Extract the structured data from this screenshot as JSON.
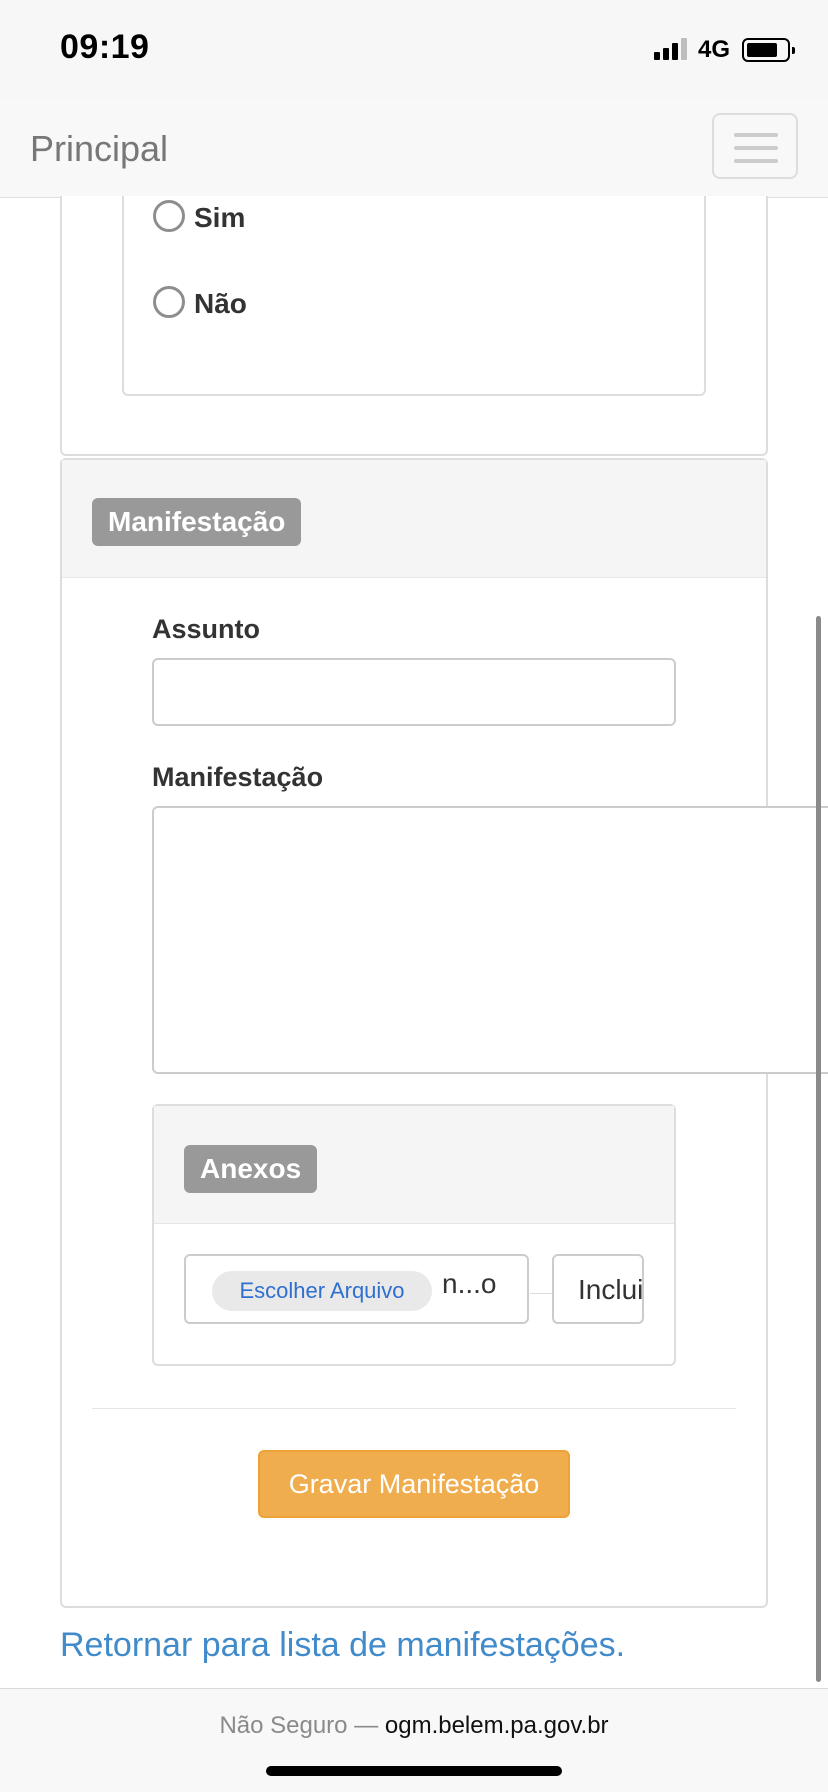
{
  "status_bar": {
    "time": "09:19",
    "network": "4G"
  },
  "navbar": {
    "brand": "Principal",
    "toggle_icon": "hamburger-icon"
  },
  "radio_group": {
    "options": [
      {
        "label": "Sim",
        "checked": false
      },
      {
        "label": "Não",
        "checked": false
      }
    ]
  },
  "manifest_panel": {
    "heading_badge": "Manifestação",
    "subject": {
      "label": "Assunto",
      "value": ""
    },
    "message": {
      "label": "Manifestação",
      "value": ""
    },
    "attachments": {
      "heading_badge": "Anexos",
      "choose_file_label": "Escolher Arquivo",
      "file_name_text": "n...o",
      "include_button": "Inclui"
    },
    "submit_button": "Gravar Manifestação"
  },
  "return_link": "Retornar para lista de manifestações.",
  "browser_bar": {
    "security_label": "Não Seguro —",
    "domain": "ogm.belem.pa.gov.br"
  },
  "colors": {
    "primary_link": "#428bca",
    "warning_button": "#f0ad4e",
    "badge": "#999999"
  }
}
